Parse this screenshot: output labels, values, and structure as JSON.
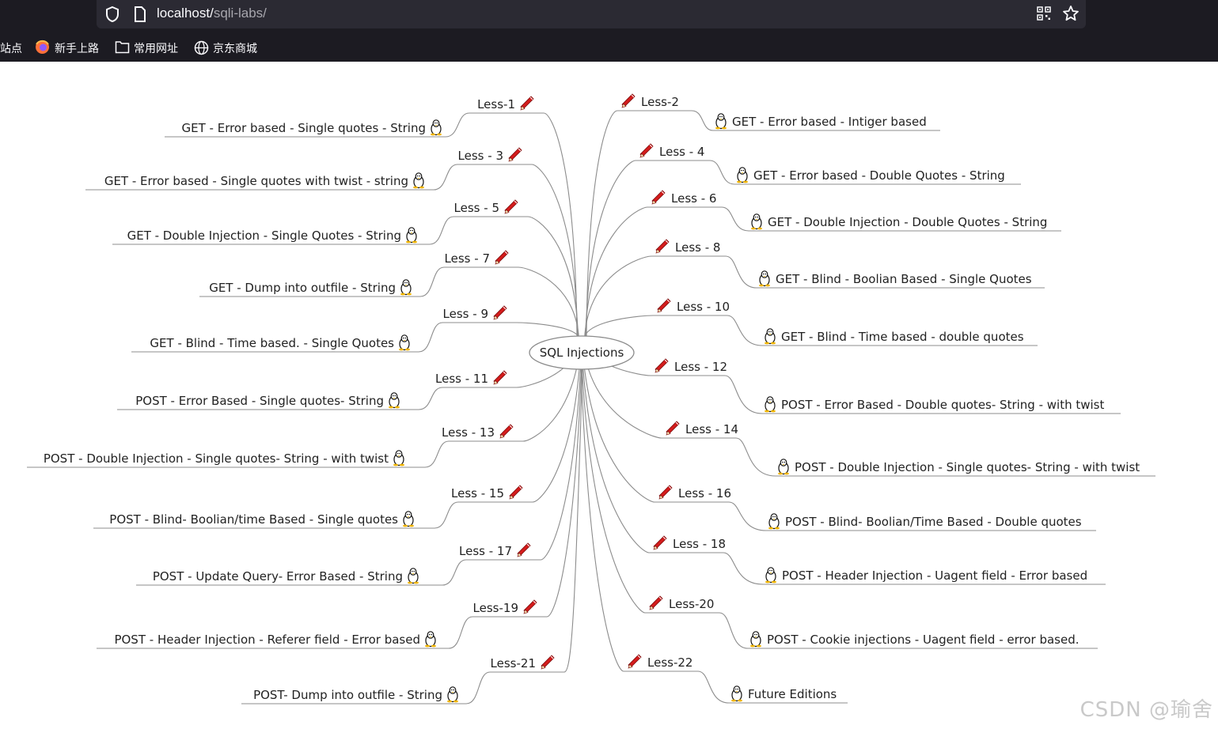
{
  "browser": {
    "url_host": "localhost/",
    "url_path": "sqli-labs/",
    "bookmarks": [
      "站点",
      "新手上路",
      "常用网址",
      "京东商城"
    ]
  },
  "mindmap": {
    "center": "SQL Injections",
    "left": [
      {
        "less": "Less-1",
        "title": "GET - Error based - Single quotes - String"
      },
      {
        "less": "Less - 3",
        "title": "GET - Error based - Single quotes with twist - string"
      },
      {
        "less": "Less - 5",
        "title": "GET - Double Injection - Single Quotes - String"
      },
      {
        "less": "Less - 7",
        "title": "GET - Dump into outfile - String"
      },
      {
        "less": "Less - 9",
        "title": "GET - Blind - Time based. -  Single Quotes"
      },
      {
        "less": "Less - 11",
        "title": "POST - Error Based - Single quotes- String"
      },
      {
        "less": "Less - 13",
        "title": "POST - Double Injection - Single quotes- String - with twist"
      },
      {
        "less": "Less - 15",
        "title": "POST - Blind- Boolian/time Based - Single quotes"
      },
      {
        "less": "Less - 17",
        "title": "POST - Update Query- Error Based - String"
      },
      {
        "less": "Less-19",
        "title": "POST - Header Injection - Referer field - Error based"
      },
      {
        "less": "Less-21",
        "title": "POST- Dump into outfile - String"
      }
    ],
    "right": [
      {
        "less": "Less-2",
        "title": "GET - Error based - Intiger based"
      },
      {
        "less": "Less - 4",
        "title": "GET - Error based - Double Quotes - String"
      },
      {
        "less": "Less - 6",
        "title": "GET - Double Injection - Double Quotes - String"
      },
      {
        "less": "Less - 8",
        "title": "GET - Blind - Boolian Based - Single Quotes"
      },
      {
        "less": "Less - 10",
        "title": "GET - Blind - Time based - double quotes"
      },
      {
        "less": "Less - 12",
        "title": "POST - Error Based - Double quotes- String - with twist"
      },
      {
        "less": "Less - 14",
        "title": "POST - Double Injection - Single quotes- String - with twist"
      },
      {
        "less": "Less - 16",
        "title": "POST - Blind- Boolian/Time Based - Double quotes"
      },
      {
        "less": "Less - 18",
        "title": "POST - Header Injection - Uagent field - Error based"
      },
      {
        "less": "Less-20",
        "title": "POST - Cookie injections - Uagent field - error based."
      },
      {
        "less": "Less-22",
        "title": "Future Editions"
      }
    ]
  },
  "watermark": "CSDN @瑜舍"
}
